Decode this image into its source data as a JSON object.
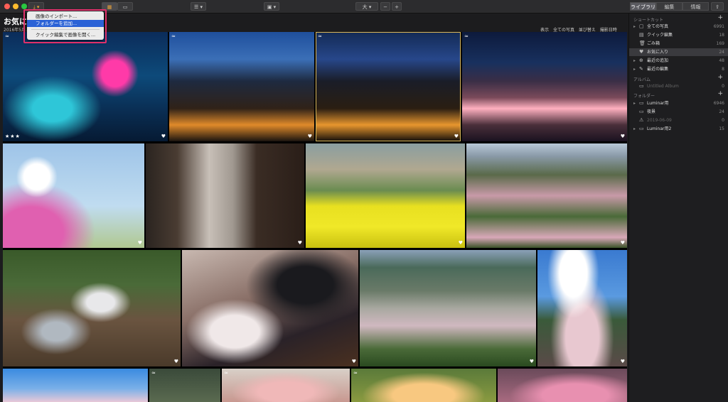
{
  "topbar": {
    "menu_dropdown": "⤓ ▾",
    "view_grid": "▦",
    "view_single": "▭",
    "filter": "☰ ▾",
    "layout": "▣ ▾",
    "size_label": "大 ▾",
    "zoom_minus": "−",
    "zoom_plus": "+",
    "tabs": [
      "ライブラリ",
      "編集",
      "情報"
    ],
    "share": "⇧"
  },
  "album": {
    "title": "お気に入り",
    "subtitle": "2016年5月..."
  },
  "sortbar": {
    "show_label": "表示",
    "show_value": "全ての写真",
    "sort_label": "並び替え",
    "sort_value": "撮影日時"
  },
  "menu": {
    "items": [
      "画像のインポート...",
      "フォルダーを追加...",
      "クイック編集で画像を開く..."
    ]
  },
  "sidebar": {
    "shortcuts_head": "ショートカット",
    "shortcuts": [
      {
        "label": "全ての写真",
        "count": "6991",
        "icon": "▢"
      },
      {
        "label": "クイック編集",
        "count": "18",
        "icon": "▤"
      },
      {
        "label": "ごみ箱",
        "count": "169",
        "icon": "🗑"
      },
      {
        "label": "お気に入り",
        "count": "24",
        "icon": "♥"
      },
      {
        "label": "最近の追加",
        "count": "48",
        "icon": "⊕"
      },
      {
        "label": "最近の編集",
        "count": "8",
        "icon": "✎"
      }
    ],
    "albums_head": "アルバム",
    "albums": [
      {
        "label": "Untitled Album",
        "count": "0"
      }
    ],
    "folders_head": "フォルダー",
    "folders": [
      {
        "label": "Luminar用",
        "count": "6946",
        "icon": "▭"
      },
      {
        "label": "夜景",
        "count": "24",
        "icon": "▭"
      },
      {
        "label": "2019-06-09",
        "count": "0",
        "icon": "⚠"
      },
      {
        "label": "Luminar用2",
        "count": "15",
        "icon": "▭"
      }
    ]
  },
  "photos": [
    {
      "name": "photo-harbor-ferris-wheel",
      "stars": "★★★"
    },
    {
      "name": "photo-city-dusk-1"
    },
    {
      "name": "photo-city-dusk-2"
    },
    {
      "name": "photo-city-night-aerial"
    },
    {
      "name": "photo-cosmos-flower"
    },
    {
      "name": "photo-old-street"
    },
    {
      "name": "photo-rapeseed-field"
    },
    {
      "name": "photo-mountain-cherry-1"
    },
    {
      "name": "photo-lucky-cats-rocks"
    },
    {
      "name": "photo-lucky-cats-rows"
    },
    {
      "name": "photo-mountain-valley"
    },
    {
      "name": "photo-cherry-tree-sky"
    },
    {
      "name": "photo-bottom-1"
    },
    {
      "name": "photo-bottom-2"
    },
    {
      "name": "photo-bottom-3"
    },
    {
      "name": "photo-bottom-4"
    },
    {
      "name": "photo-bottom-5"
    }
  ],
  "colors": {
    "menu_highlight": "#2b62d6",
    "annotation_box": "#e0306a",
    "selection_outline": "#d9b75a"
  }
}
